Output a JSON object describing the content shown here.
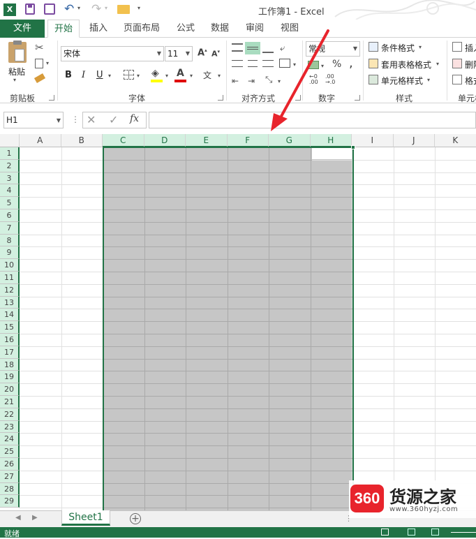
{
  "title": {
    "text": "工作簿1 - Excel"
  },
  "tabs": [
    {
      "label": "文件"
    },
    {
      "label": "开始"
    },
    {
      "label": "插入"
    },
    {
      "label": "页面布局"
    },
    {
      "label": "公式"
    },
    {
      "label": "数据"
    },
    {
      "label": "审阅"
    },
    {
      "label": "视图"
    }
  ],
  "ribbon": {
    "clipboard": {
      "paste_label": "粘贴",
      "group_label": "剪贴板"
    },
    "font": {
      "font_name": "宋体",
      "font_size": "11",
      "bold": "B",
      "italic": "I",
      "underline": "U",
      "font_color_glyph": "A",
      "phonetic_glyph": "文",
      "group_label": "字体"
    },
    "alignment": {
      "group_label": "对齐方式"
    },
    "number": {
      "format": "常规",
      "percent": "%",
      "comma": ",",
      "group_label": "数字"
    },
    "styles": {
      "conditional": "条件格式",
      "table": "套用表格格式",
      "cell": "单元格样式",
      "group_label": "样式"
    },
    "cells": {
      "insert": "插入",
      "delete": "删除",
      "format": "格式",
      "group_label": "单元格"
    }
  },
  "formula_bar": {
    "name_box": "H1",
    "fx": "fx",
    "value": ""
  },
  "columns": [
    "A",
    "B",
    "C",
    "D",
    "E",
    "F",
    "G",
    "H",
    "I",
    "J",
    "K"
  ],
  "rows": [
    "1",
    "2",
    "3",
    "4",
    "5",
    "6",
    "7",
    "8",
    "9",
    "10",
    "11",
    "12",
    "13",
    "14",
    "15",
    "16",
    "17",
    "18",
    "19",
    "20",
    "21",
    "22",
    "23",
    "24",
    "25",
    "26",
    "27",
    "28",
    "29"
  ],
  "sheet_tab": {
    "name": "Sheet1"
  },
  "status": {
    "text": "就绪"
  },
  "watermark": {
    "logo": "360",
    "name": "货源之家",
    "url": "www.360hyzj.com"
  },
  "colors": {
    "accent": "#217346",
    "selection_fill": "#c6c6c6",
    "selected_header": "#d3f0e0",
    "arrow": "#e8242c"
  }
}
